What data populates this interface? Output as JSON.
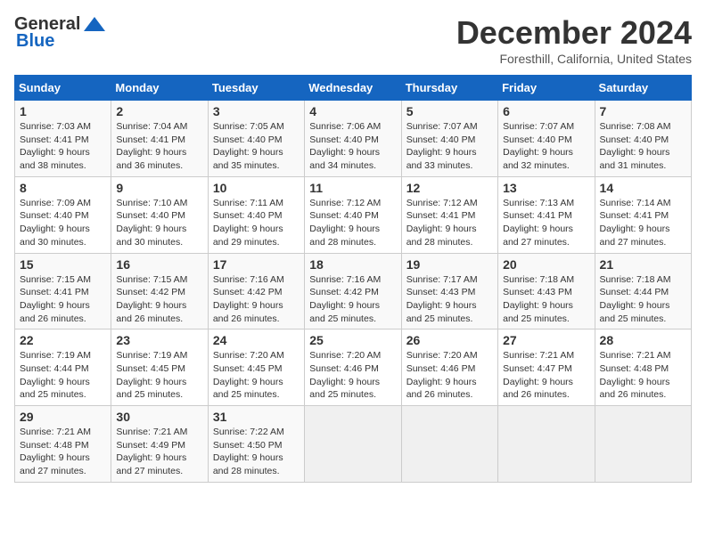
{
  "logo": {
    "general": "General",
    "blue": "Blue"
  },
  "title": "December 2024",
  "location": "Foresthill, California, United States",
  "days_header": [
    "Sunday",
    "Monday",
    "Tuesday",
    "Wednesday",
    "Thursday",
    "Friday",
    "Saturday"
  ],
  "weeks": [
    [
      {
        "day": "1",
        "info": "Sunrise: 7:03 AM\nSunset: 4:41 PM\nDaylight: 9 hours\nand 38 minutes."
      },
      {
        "day": "2",
        "info": "Sunrise: 7:04 AM\nSunset: 4:41 PM\nDaylight: 9 hours\nand 36 minutes."
      },
      {
        "day": "3",
        "info": "Sunrise: 7:05 AM\nSunset: 4:40 PM\nDaylight: 9 hours\nand 35 minutes."
      },
      {
        "day": "4",
        "info": "Sunrise: 7:06 AM\nSunset: 4:40 PM\nDaylight: 9 hours\nand 34 minutes."
      },
      {
        "day": "5",
        "info": "Sunrise: 7:07 AM\nSunset: 4:40 PM\nDaylight: 9 hours\nand 33 minutes."
      },
      {
        "day": "6",
        "info": "Sunrise: 7:07 AM\nSunset: 4:40 PM\nDaylight: 9 hours\nand 32 minutes."
      },
      {
        "day": "7",
        "info": "Sunrise: 7:08 AM\nSunset: 4:40 PM\nDaylight: 9 hours\nand 31 minutes."
      }
    ],
    [
      {
        "day": "8",
        "info": "Sunrise: 7:09 AM\nSunset: 4:40 PM\nDaylight: 9 hours\nand 30 minutes."
      },
      {
        "day": "9",
        "info": "Sunrise: 7:10 AM\nSunset: 4:40 PM\nDaylight: 9 hours\nand 30 minutes."
      },
      {
        "day": "10",
        "info": "Sunrise: 7:11 AM\nSunset: 4:40 PM\nDaylight: 9 hours\nand 29 minutes."
      },
      {
        "day": "11",
        "info": "Sunrise: 7:12 AM\nSunset: 4:40 PM\nDaylight: 9 hours\nand 28 minutes."
      },
      {
        "day": "12",
        "info": "Sunrise: 7:12 AM\nSunset: 4:41 PM\nDaylight: 9 hours\nand 28 minutes."
      },
      {
        "day": "13",
        "info": "Sunrise: 7:13 AM\nSunset: 4:41 PM\nDaylight: 9 hours\nand 27 minutes."
      },
      {
        "day": "14",
        "info": "Sunrise: 7:14 AM\nSunset: 4:41 PM\nDaylight: 9 hours\nand 27 minutes."
      }
    ],
    [
      {
        "day": "15",
        "info": "Sunrise: 7:15 AM\nSunset: 4:41 PM\nDaylight: 9 hours\nand 26 minutes."
      },
      {
        "day": "16",
        "info": "Sunrise: 7:15 AM\nSunset: 4:42 PM\nDaylight: 9 hours\nand 26 minutes."
      },
      {
        "day": "17",
        "info": "Sunrise: 7:16 AM\nSunset: 4:42 PM\nDaylight: 9 hours\nand 26 minutes."
      },
      {
        "day": "18",
        "info": "Sunrise: 7:16 AM\nSunset: 4:42 PM\nDaylight: 9 hours\nand 25 minutes."
      },
      {
        "day": "19",
        "info": "Sunrise: 7:17 AM\nSunset: 4:43 PM\nDaylight: 9 hours\nand 25 minutes."
      },
      {
        "day": "20",
        "info": "Sunrise: 7:18 AM\nSunset: 4:43 PM\nDaylight: 9 hours\nand 25 minutes."
      },
      {
        "day": "21",
        "info": "Sunrise: 7:18 AM\nSunset: 4:44 PM\nDaylight: 9 hours\nand 25 minutes."
      }
    ],
    [
      {
        "day": "22",
        "info": "Sunrise: 7:19 AM\nSunset: 4:44 PM\nDaylight: 9 hours\nand 25 minutes."
      },
      {
        "day": "23",
        "info": "Sunrise: 7:19 AM\nSunset: 4:45 PM\nDaylight: 9 hours\nand 25 minutes."
      },
      {
        "day": "24",
        "info": "Sunrise: 7:20 AM\nSunset: 4:45 PM\nDaylight: 9 hours\nand 25 minutes."
      },
      {
        "day": "25",
        "info": "Sunrise: 7:20 AM\nSunset: 4:46 PM\nDaylight: 9 hours\nand 25 minutes."
      },
      {
        "day": "26",
        "info": "Sunrise: 7:20 AM\nSunset: 4:46 PM\nDaylight: 9 hours\nand 26 minutes."
      },
      {
        "day": "27",
        "info": "Sunrise: 7:21 AM\nSunset: 4:47 PM\nDaylight: 9 hours\nand 26 minutes."
      },
      {
        "day": "28",
        "info": "Sunrise: 7:21 AM\nSunset: 4:48 PM\nDaylight: 9 hours\nand 26 minutes."
      }
    ],
    [
      {
        "day": "29",
        "info": "Sunrise: 7:21 AM\nSunset: 4:48 PM\nDaylight: 9 hours\nand 27 minutes."
      },
      {
        "day": "30",
        "info": "Sunrise: 7:21 AM\nSunset: 4:49 PM\nDaylight: 9 hours\nand 27 minutes."
      },
      {
        "day": "31",
        "info": "Sunrise: 7:22 AM\nSunset: 4:50 PM\nDaylight: 9 hours\nand 28 minutes."
      },
      {
        "day": "",
        "info": ""
      },
      {
        "day": "",
        "info": ""
      },
      {
        "day": "",
        "info": ""
      },
      {
        "day": "",
        "info": ""
      }
    ]
  ]
}
